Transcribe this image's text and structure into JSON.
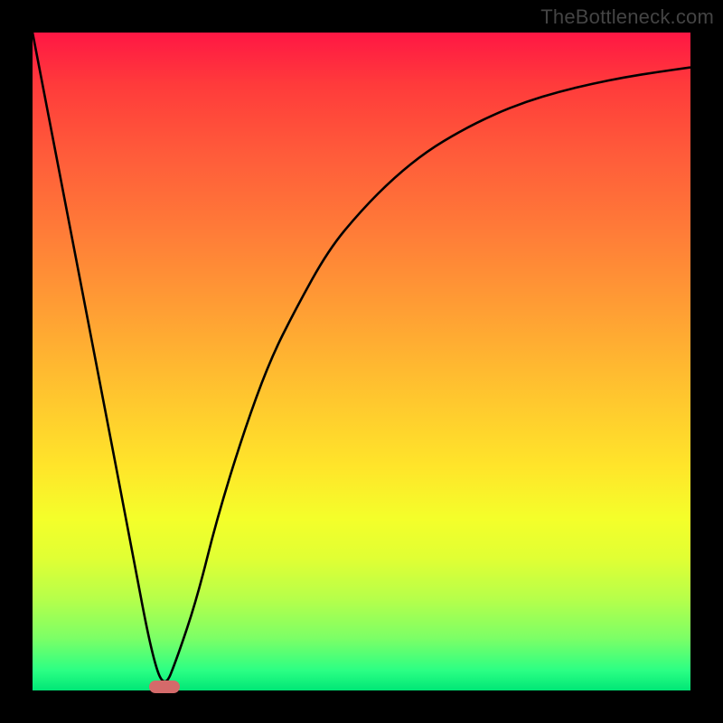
{
  "watermark": "TheBottleneck.com",
  "chart_data": {
    "type": "line",
    "title": "",
    "xlabel": "",
    "ylabel": "",
    "xlim": [
      0,
      100
    ],
    "ylim": [
      0,
      100
    ],
    "series": [
      {
        "name": "curve",
        "x": [
          0,
          5,
          10,
          15,
          18,
          20,
          22,
          25,
          28,
          32,
          36,
          40,
          45,
          50,
          55,
          60,
          65,
          70,
          75,
          80,
          85,
          90,
          95,
          100
        ],
        "y": [
          100,
          74,
          48,
          22,
          6,
          0,
          5,
          14,
          26,
          39,
          50,
          58,
          67,
          73,
          78,
          82,
          85,
          87.5,
          89.5,
          91,
          92.2,
          93.2,
          94,
          94.7
        ]
      }
    ],
    "marker": {
      "x": 20,
      "y": 0.5
    },
    "background_gradient_stops": [
      {
        "pos": 0,
        "color": "#ff1744"
      },
      {
        "pos": 50,
        "color": "#ffb22e"
      },
      {
        "pos": 75,
        "color": "#f4ff2a"
      },
      {
        "pos": 100,
        "color": "#00e676"
      }
    ]
  }
}
